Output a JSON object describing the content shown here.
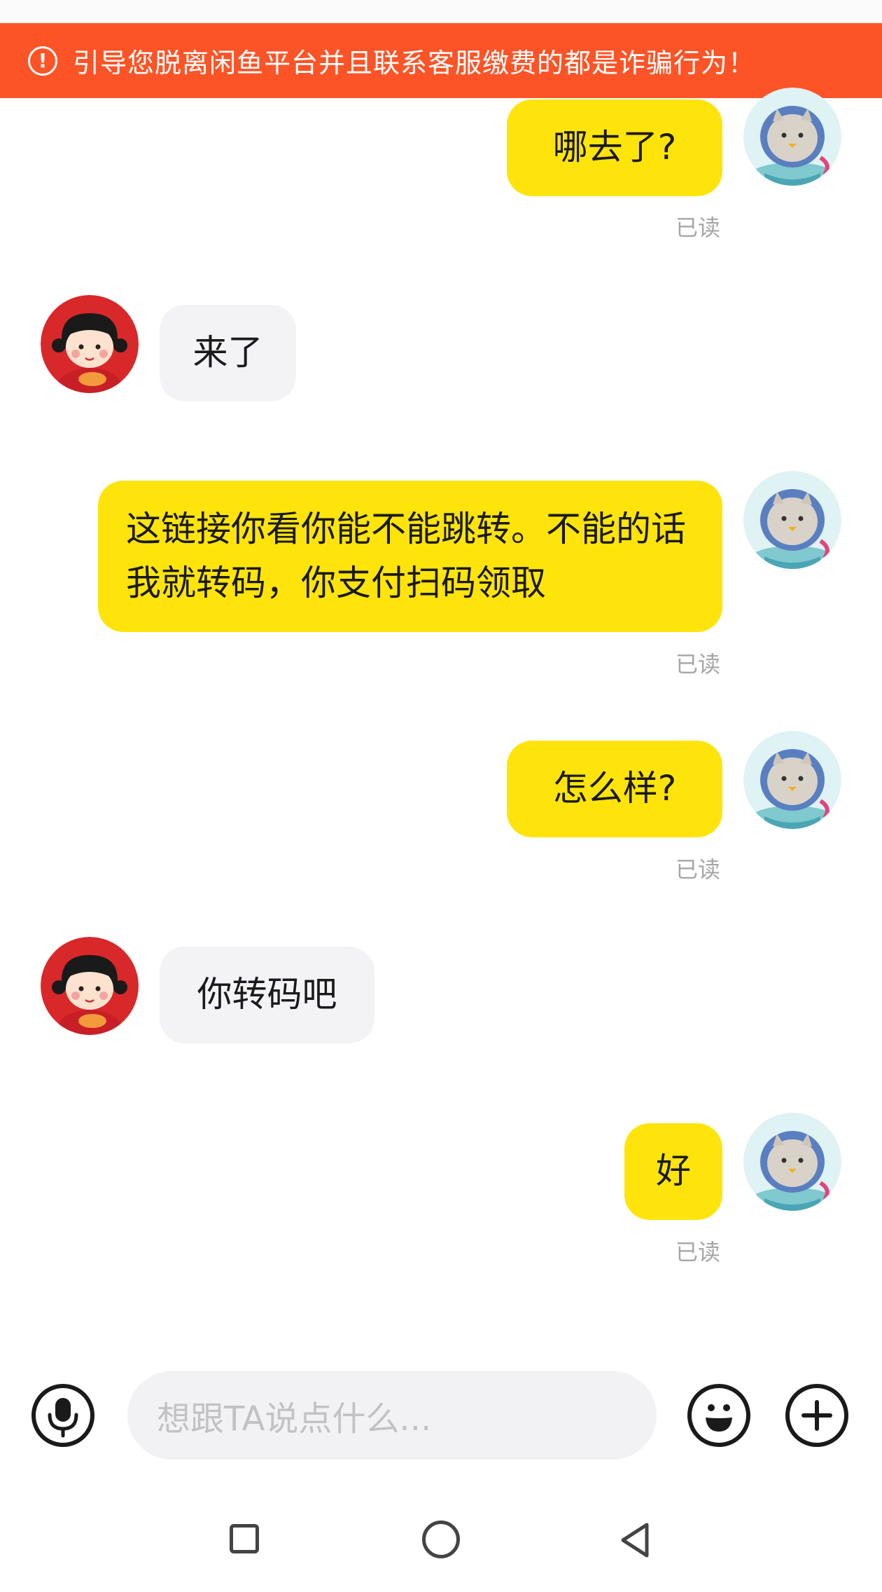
{
  "banner": {
    "icon": "!",
    "text": "引导您脱离闲鱼平台并且联系客服缴费的都是诈骗行为！",
    "color": "#fd5427"
  },
  "messages": [
    {
      "sender": "me",
      "text": "哪去了?",
      "read_label": "已读"
    },
    {
      "sender": "other",
      "text": "来了"
    },
    {
      "sender": "me",
      "text": "这链接你看你能不能跳转。不能的话我就转码，你支付扫码领取",
      "read_label": "已读"
    },
    {
      "sender": "me",
      "text": "怎么样?",
      "read_label": "已读"
    },
    {
      "sender": "other",
      "text": "你转码吧"
    },
    {
      "sender": "me",
      "text": "好",
      "read_label": "已读"
    }
  ],
  "input": {
    "placeholder": "想跟TA说点什么..."
  },
  "icons": {
    "voice": "microphone-icon",
    "emoji": "emoji-icon",
    "more": "plus-icon",
    "nav_recent": "square-icon",
    "nav_home": "circle-icon",
    "nav_back": "triangle-back-icon"
  },
  "colors": {
    "my_bubble": "#fee40b",
    "other_bubble": "#f3f3f5",
    "read_text": "#a6a6a6"
  }
}
